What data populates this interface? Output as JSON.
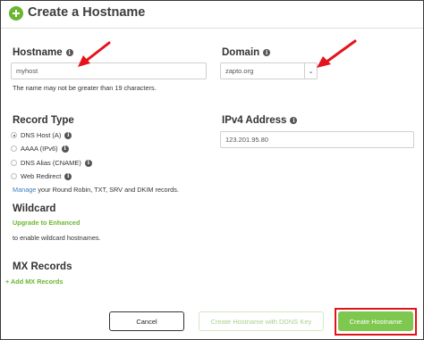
{
  "header": {
    "title": "Create a Hostname"
  },
  "hostname": {
    "label": "Hostname",
    "value": "myhost",
    "hint": "The name may not be greater than 19 characters."
  },
  "domain": {
    "label": "Domain",
    "value": "zapto.org"
  },
  "record_type": {
    "label": "Record Type",
    "options": [
      {
        "label": "DNS Host (A)"
      },
      {
        "label": "AAAA (IPv6)"
      },
      {
        "label": "DNS Alias (CNAME)"
      },
      {
        "label": "Web Redirect"
      }
    ],
    "selected": "DNS Host (A)",
    "manage_link": "Manage",
    "manage_text": " your Round Robin, TXT, SRV and DKIM records."
  },
  "ipv4": {
    "label": "IPv4 Address",
    "value": "123.201.95.80"
  },
  "wildcard": {
    "label": "Wildcard",
    "upgrade_link": "Upgrade to Enhanced",
    "hint": "to enable wildcard hostnames."
  },
  "mx": {
    "label": "MX Records",
    "add_link": "+ Add MX Records"
  },
  "buttons": {
    "cancel": "Cancel",
    "ddns": "Create Hostname with DDNS Key",
    "create": "Create Hostname"
  },
  "colors": {
    "brand_green": "#6ab630",
    "link_blue": "#3d7fc4",
    "highlight_red": "#e0131b",
    "annotation_arrow": "#e3141c"
  }
}
